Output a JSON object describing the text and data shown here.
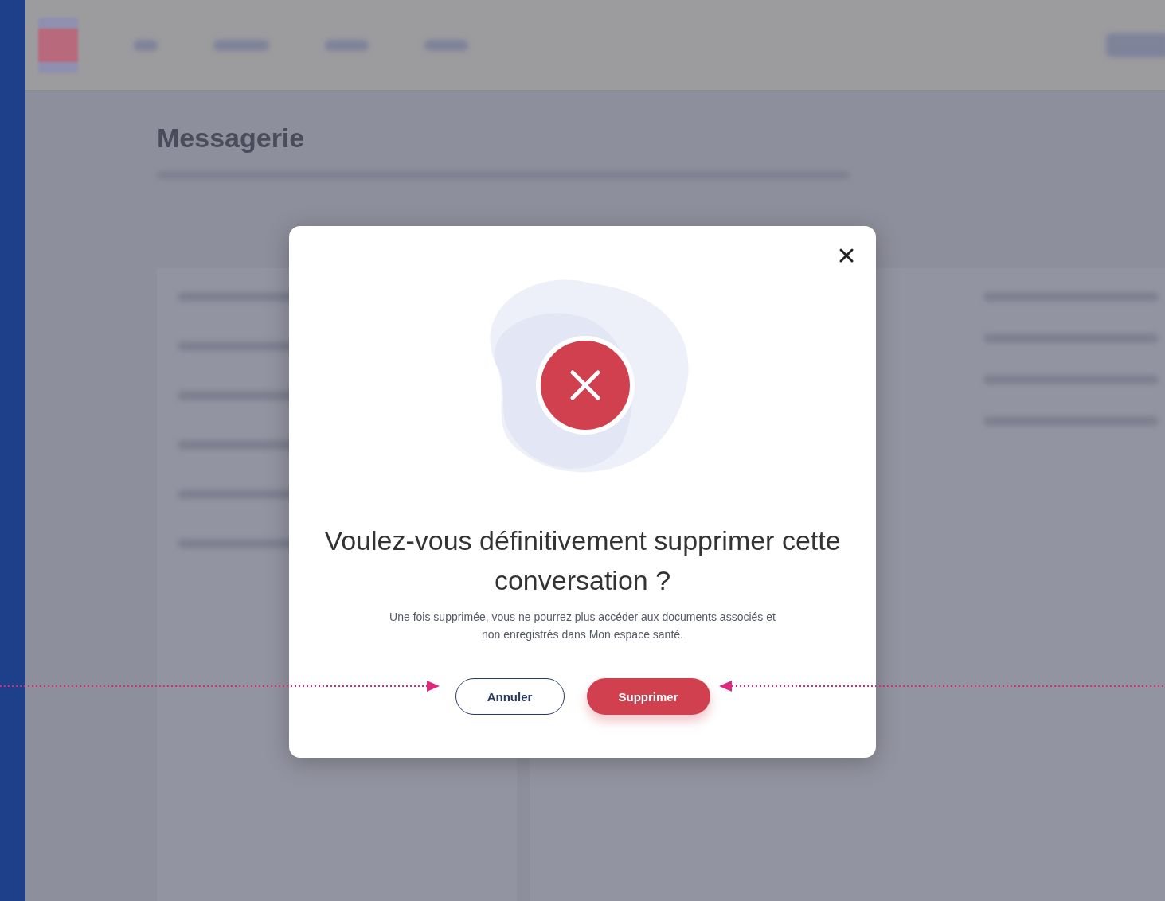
{
  "page": {
    "title": "Messagerie"
  },
  "dialog": {
    "title": "Voulez-vous définitivement supprimer cette conversation ?",
    "message": "Une fois supprimée, vous ne pourrez plus accéder aux documents associés et non enregistrés dans Mon espace santé.",
    "buttons": [
      {
        "label": "Annuler",
        "kind": "secondary"
      },
      {
        "label": "Supprimer",
        "kind": "danger"
      }
    ]
  }
}
